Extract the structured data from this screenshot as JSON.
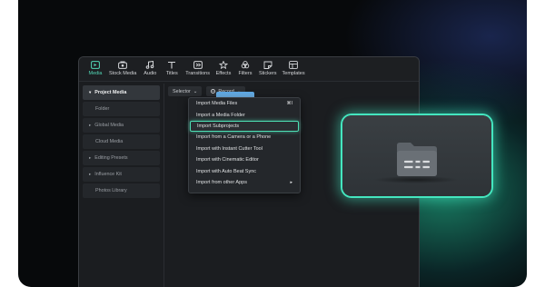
{
  "toolbar": {
    "items": [
      {
        "label": "Media",
        "icon": "media-icon",
        "active": true
      },
      {
        "label": "Stock Media",
        "icon": "stock-media-icon"
      },
      {
        "label": "Audio",
        "icon": "audio-icon"
      },
      {
        "label": "Titles",
        "icon": "titles-icon"
      },
      {
        "label": "Transitions",
        "icon": "transitions-icon"
      },
      {
        "label": "Effects",
        "icon": "effects-icon"
      },
      {
        "label": "Filters",
        "icon": "filters-icon"
      },
      {
        "label": "Stickers",
        "icon": "stickers-icon"
      },
      {
        "label": "Templates",
        "icon": "templates-icon"
      }
    ]
  },
  "sidebar": {
    "items": [
      {
        "label": "Project Media",
        "arrow": "▾",
        "selected": true
      },
      {
        "label": "Folder"
      },
      {
        "label": "Global Media",
        "arrow": "▸"
      },
      {
        "label": "Cloud Media"
      },
      {
        "label": "Editing Presets",
        "arrow": "▸"
      },
      {
        "label": "Influence Kit",
        "arrow": "▸"
      },
      {
        "label": "Photos Library"
      }
    ]
  },
  "filters": {
    "selector_label": "Selector",
    "record_label": "Record",
    "chevron": "⌄"
  },
  "import_menu": {
    "items": [
      {
        "label": "Import Media Files",
        "shortcut": "⌘I"
      },
      {
        "label": "Import a Media Folder"
      },
      {
        "label": "Import Subprojects",
        "highlighted": true
      },
      {
        "label": "Import from a Camera or a Phone"
      },
      {
        "label": "Import with Instant Cutter Tool"
      },
      {
        "label": "Import with Cinematic Editor"
      },
      {
        "label": "Import with Auto Beat Sync"
      },
      {
        "label": "Import from other Apps",
        "submenu": "▸"
      }
    ]
  },
  "colors": {
    "accent": "#4ee0b5",
    "app_bg": "#1b1d20"
  }
}
